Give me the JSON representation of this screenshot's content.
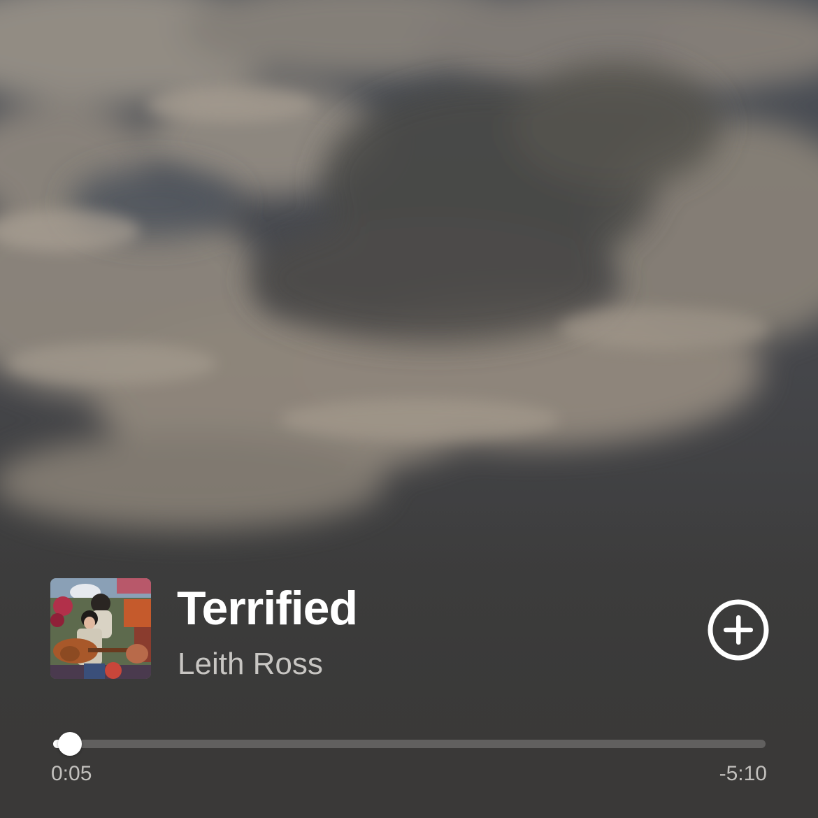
{
  "background": {
    "description_icon": "cloudy-sky-canvas",
    "sky_color": "#3e3d3c",
    "cloud_color": "#a39a8e"
  },
  "track": {
    "title": "Terrified",
    "artist": "Leith Ross",
    "album_art_icon": "album-cover-guitar-player"
  },
  "controls": {
    "add_icon": "add-circle-icon"
  },
  "progress": {
    "elapsed": "0:05",
    "remaining": "-5:10",
    "fraction": 0.016
  },
  "colors": {
    "accent": "#ffffff",
    "text_secondary": "#c8c6c3"
  }
}
